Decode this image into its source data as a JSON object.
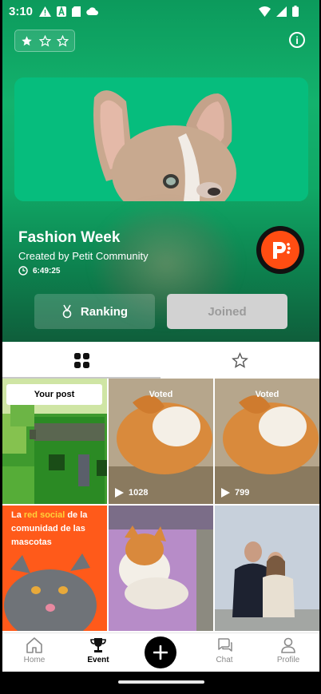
{
  "status_bar": {
    "time": "3:10"
  },
  "event": {
    "title": "Fashion Week",
    "creator": "Created by Petit Community",
    "timer": "6:49:25"
  },
  "buttons": {
    "ranking": "Ranking",
    "joined": "Joined"
  },
  "grid": {
    "your_post_label": "Your post",
    "posts": [
      {
        "badge": "Voted",
        "votes": "1028"
      },
      {
        "badge": "Voted",
        "votes": "799"
      }
    ],
    "promo": {
      "prefix": "La ",
      "highlight": "red social",
      "suffix": " de la comunidad de las mascotas"
    }
  },
  "bottom_nav": {
    "items": [
      {
        "label": "Home"
      },
      {
        "label": "Event"
      },
      {
        "label": "Chat"
      },
      {
        "label": "Profile"
      }
    ]
  },
  "colors": {
    "hero_green": "#13b26d",
    "brand_orange": "#ff4d12",
    "joined_bg": "#d2d2d2"
  },
  "icons": [
    "warning-icon",
    "a-icon",
    "sd-card-icon",
    "cloud-icon",
    "wifi-icon",
    "signal-icon",
    "battery-icon",
    "star-icon",
    "info-icon",
    "clock-icon",
    "medal-icon",
    "grid-icon",
    "play-icon",
    "home-icon",
    "trophy-icon",
    "plus-icon",
    "chat-icon",
    "profile-icon"
  ]
}
